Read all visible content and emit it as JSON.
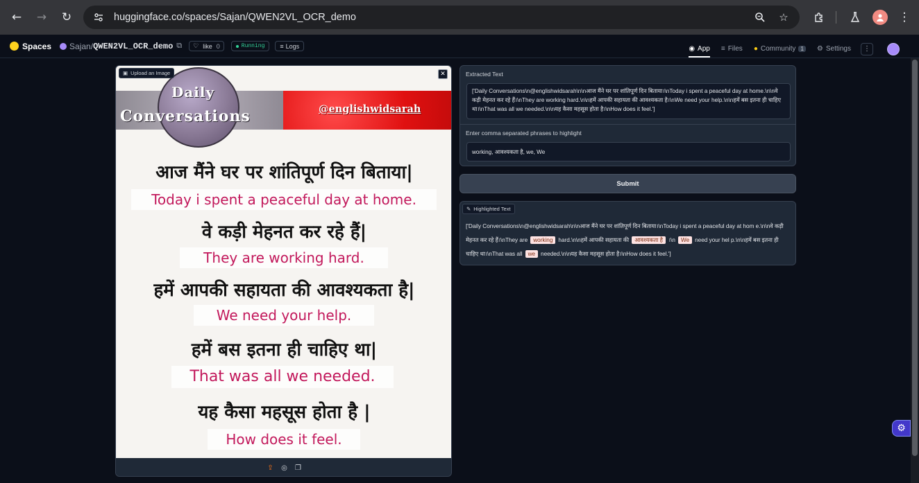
{
  "browser": {
    "url": "huggingface.co/spaces/Sajan/QWEN2VL_OCR_demo"
  },
  "header": {
    "spaces_label": "Spaces",
    "user": "Sajan",
    "slash": "/",
    "repo": "QWEN2VL_OCR_demo",
    "like_label": "like",
    "like_count": "0",
    "status": "Running",
    "logs_label": "Logs",
    "tabs": [
      {
        "label": "App",
        "active": true
      },
      {
        "label": "Files"
      },
      {
        "label": "Community",
        "count": "1"
      },
      {
        "label": "Settings"
      }
    ]
  },
  "image_panel": {
    "label": "Upload an Image",
    "image": {
      "title_line1": "Daily",
      "title_line2": "Conversations",
      "handle": "@englishwidsarah",
      "lines": [
        {
          "hi": "आज मैंने घर पर शांतिपूर्ण दिन बिताया|",
          "en": "Today i spent a peaceful day at home."
        },
        {
          "hi": "वे कड़ी मेहनत कर रहे हैं|",
          "en": "They are working hard."
        },
        {
          "hi": "हमें आपकी सहायता की आवश्यकता है|",
          "en": "We need your help."
        },
        {
          "hi": "हमें बस इतना ही चाहिए था|",
          "en": "That was all we needed."
        },
        {
          "hi": "यह कैसा महसूस होता है |",
          "en": "How does it feel."
        }
      ]
    }
  },
  "extracted": {
    "label": "Extracted Text",
    "value": "['Daily Conversations\\n@englishwidsarah\\n\\nआज मैंने घर पर शांतिपूर्ण दिन बिताया।\\nToday i spent a peaceful day at home.\\n\\nवे कड़ी मेहनत कर रहे हैं।\\nThey are working hard.\\n\\nहमें आपकी सहायता की आवश्यकता है।\\nWe need your help.\\n\\nहमें बस इतना ही चाहिए था।\\nThat was all we needed.\\n\\nयह कैसा महसूस होता है।\\nHow does it feel.']"
  },
  "phrases": {
    "label": "Enter comma separated phrases to highlight",
    "value": "working, आवश्यकता है, we, We"
  },
  "submit_label": "Submit",
  "highlighted": {
    "label": "Highlighted Text",
    "seg1": "['Daily Conversations\\n@englishwidsarah\\n\\nआज मैंने घर पर शांतिपूर्ण दिन बिताया।\\nToday i spent a peaceful day at hom e.\\n\\nवे कड़ी मेहनत कर रहे हैं।\\nThey are",
    "mark1": "working",
    "seg2": "hard.\\n\\nहमें आपकी सहायता की",
    "mark2": "आवश्यकता है",
    "seg3": "।\\n",
    "mark3": "We",
    "seg4": "need your hel p.\\n\\nहमें बस इतना ही चाहिए था।\\nThat was all",
    "mark4": "we",
    "seg5": "needed.\\n\\nयह कैसा महसूस होता है।\\nHow does it feel.']"
  },
  "icons": {
    "back": "arrow-left-icon",
    "forward": "arrow-right-icon",
    "reload": "reload-icon",
    "settings_fab": "gear-icon"
  }
}
